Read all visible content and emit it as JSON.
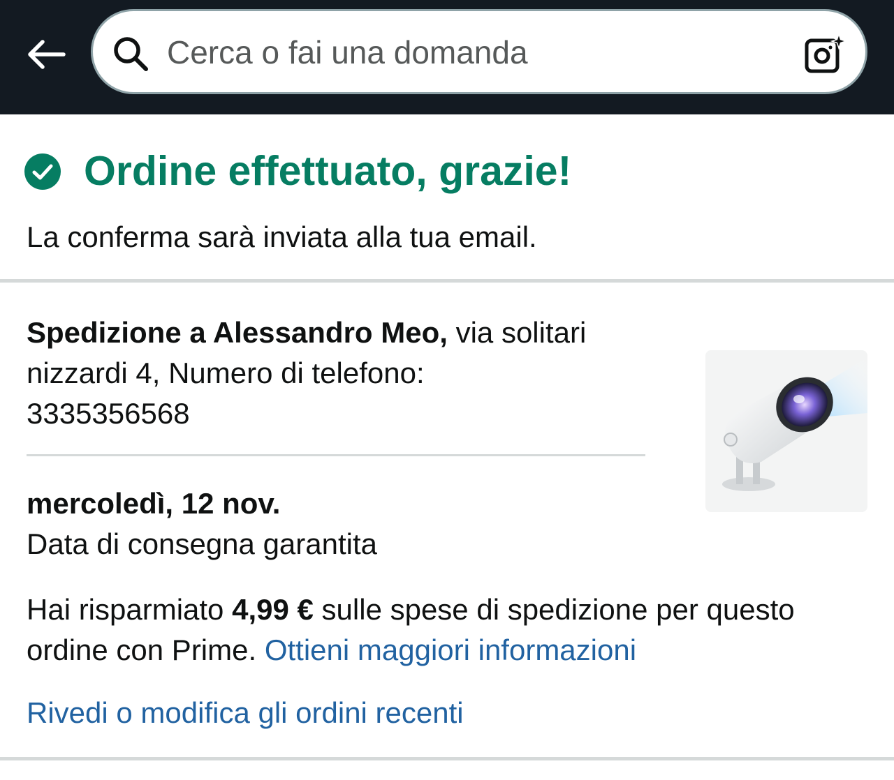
{
  "search": {
    "placeholder": "Cerca o fai una domanda"
  },
  "icons": {
    "back": "arrow-left-icon",
    "search": "search-icon",
    "camera": "camera-sparkle-icon",
    "confirm": "check-circle-icon"
  },
  "confirmation": {
    "title": "Ordine effettuato, grazie!",
    "subtitle": "La conferma sarà inviata alla tua email."
  },
  "shipping": {
    "recipient_label": "Spedizione a Alessandro Meo,",
    "address_line": " via solitari nizzardi 4, Numero di telefono:",
    "phone": "3335356568"
  },
  "delivery": {
    "date": "mercoledì, 12 nov.",
    "note": "Data di consegna garantita"
  },
  "savings": {
    "prefix": "Hai risparmiato ",
    "amount": "4,99 €",
    "suffix": " sulle spese di spedizione per questo ordine con Prime. ",
    "info_link": "Ottieni maggiori informazioni"
  },
  "orders_link": "Rivedi o modifica gli ordini recenti",
  "colors": {
    "topbar": "#131a22",
    "success": "#067d62",
    "link": "#2162a1",
    "divider": "#d5d9d9"
  }
}
